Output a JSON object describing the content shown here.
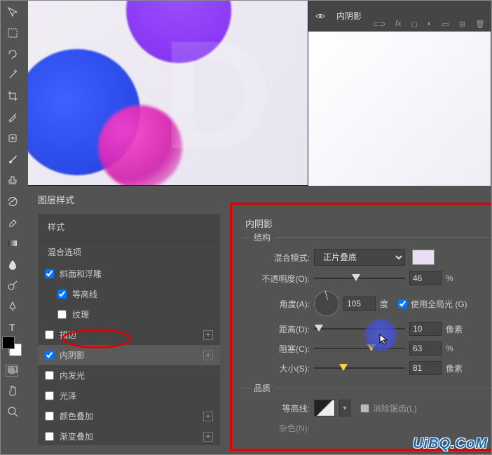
{
  "layers_panel": {
    "visible_layer": "内阴影",
    "footer_icons": [
      "co",
      "fx",
      "mask",
      "adjust",
      "group",
      "new",
      "trash"
    ]
  },
  "dialog": {
    "title": "图层样式",
    "left": {
      "header": "样式",
      "blend_options": "混合选项",
      "items": [
        {
          "label": "斜面和浮雕",
          "checked": true,
          "indent": 0,
          "plus": false
        },
        {
          "label": "等高线",
          "checked": true,
          "indent": 1,
          "plus": false
        },
        {
          "label": "纹理",
          "checked": false,
          "indent": 1,
          "plus": false
        },
        {
          "label": "描边",
          "checked": false,
          "indent": 0,
          "plus": true
        },
        {
          "label": "内阴影",
          "checked": true,
          "indent": 0,
          "plus": true,
          "selected": true
        },
        {
          "label": "内发光",
          "checked": false,
          "indent": 0,
          "plus": false
        },
        {
          "label": "光泽",
          "checked": false,
          "indent": 0,
          "plus": false
        },
        {
          "label": "颜色叠加",
          "checked": false,
          "indent": 0,
          "plus": true
        },
        {
          "label": "渐变叠加",
          "checked": false,
          "indent": 0,
          "plus": true
        }
      ]
    },
    "right": {
      "title": "内阴影",
      "structure_legend": "结构",
      "blend_mode_label": "混合模式:",
      "blend_mode_value": "正片叠底",
      "color_swatch": "#e8dff5",
      "opacity_label": "不透明度(O):",
      "opacity_value": "46",
      "opacity_unit": "%",
      "angle_label": "角度(A):",
      "angle_value": "105",
      "angle_unit": "度",
      "global_light_label": "使用全局光 (G)",
      "global_light_checked": true,
      "distance_label": "距离(D):",
      "distance_value": "10",
      "distance_unit": "像素",
      "choke_label": "阻塞(C):",
      "choke_value": "63",
      "choke_unit": "%",
      "size_label": "大小(S):",
      "size_value": "81",
      "size_unit": "像素",
      "quality_legend": "品质",
      "contour_label": "等高线:",
      "antialias_label": "消除锯齿(L)",
      "noise_label": "杂色(N):"
    }
  },
  "watermark": "UiBQ.CoM"
}
